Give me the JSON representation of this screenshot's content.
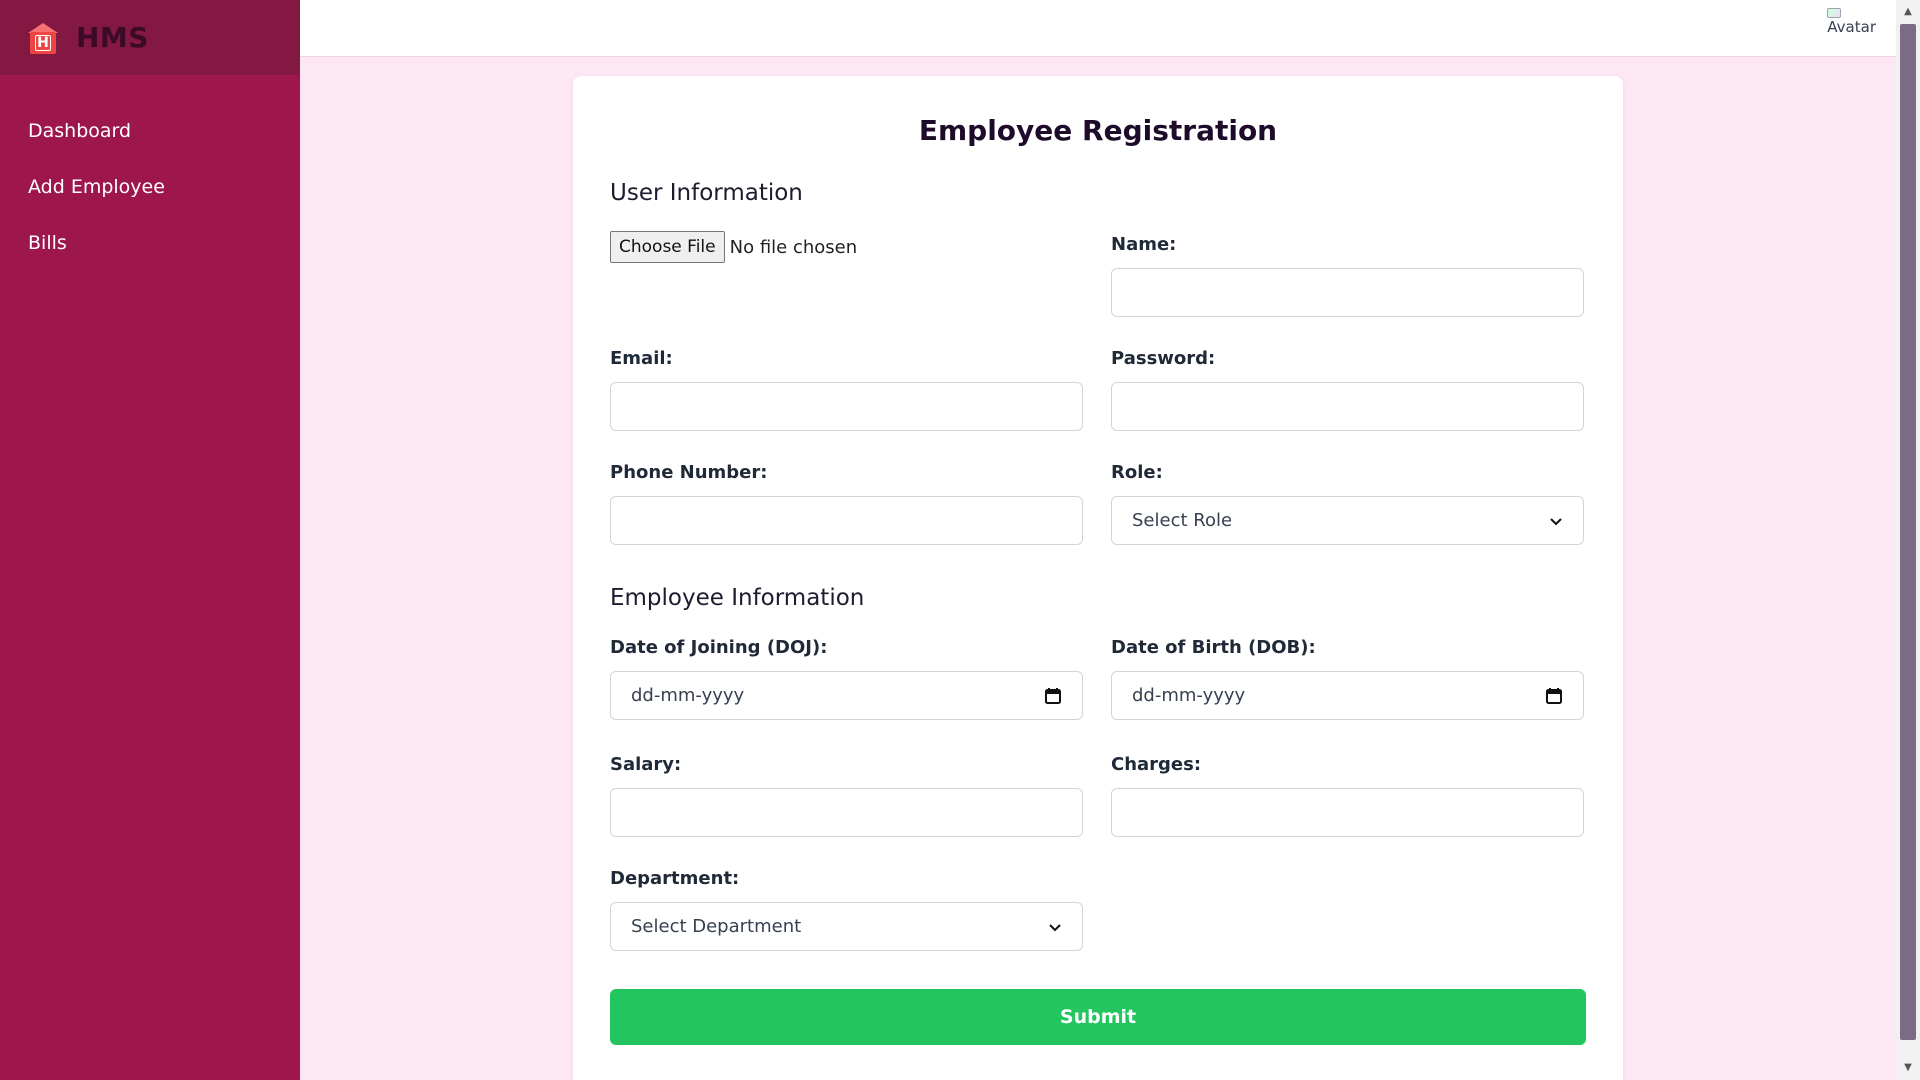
{
  "brand": {
    "title": "HMS",
    "logo_letter": "H"
  },
  "sidebar": {
    "items": [
      {
        "label": "Dashboard"
      },
      {
        "label": "Add Employee"
      },
      {
        "label": "Bills"
      }
    ]
  },
  "topbar": {
    "avatar_alt": "Avatar"
  },
  "form": {
    "title": "Employee Registration",
    "user_section_title": "User Information",
    "file": {
      "button_label": "Choose File",
      "status": "No file chosen"
    },
    "name": {
      "label": "Name:",
      "value": ""
    },
    "email": {
      "label": "Email:",
      "value": ""
    },
    "password": {
      "label": "Password:",
      "value": ""
    },
    "phone": {
      "label": "Phone Number:",
      "value": ""
    },
    "role": {
      "label": "Role:",
      "selected": "Select Role"
    },
    "employee_section_title": "Employee Information",
    "doj": {
      "label": "Date of Joining (DOJ):",
      "placeholder": "dd-mm-yyyy"
    },
    "dob": {
      "label": "Date of Birth (DOB):",
      "placeholder": "dd-mm-yyyy"
    },
    "salary": {
      "label": "Salary:",
      "value": ""
    },
    "charges": {
      "label": "Charges:",
      "value": ""
    },
    "department": {
      "label": "Department:",
      "selected": "Select Department"
    },
    "submit_label": "Submit"
  },
  "colors": {
    "sidebar": "#9d174d",
    "brand_bar": "#831843",
    "page_bg": "#fce7f3",
    "submit": "#22c55e"
  },
  "icons": [
    "hospital-logo-icon",
    "chevron-down-icon",
    "calendar-icon",
    "avatar-image"
  ]
}
